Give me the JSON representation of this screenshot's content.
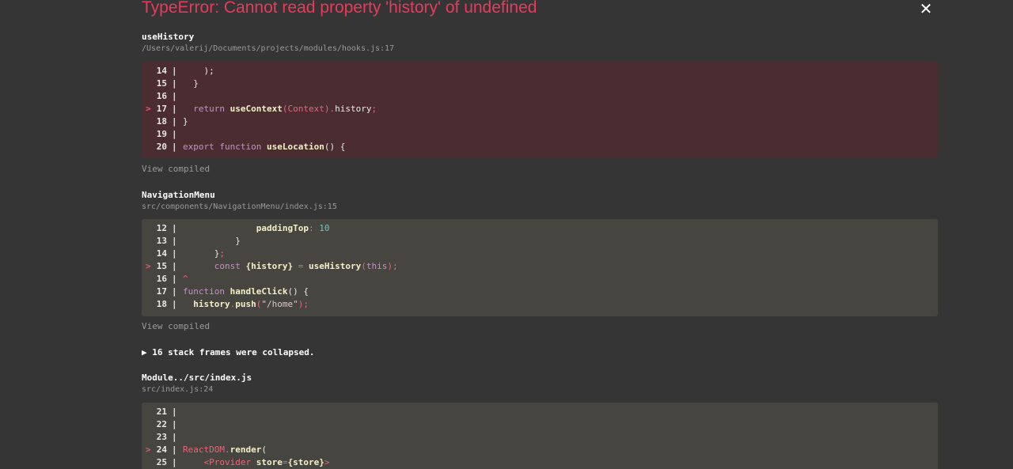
{
  "error": {
    "title": "TypeError: Cannot read property 'history' of undefined",
    "close_label": "✕"
  },
  "frames": [
    {
      "name": "useHistory",
      "path": "/Users/valerij/Documents/projects/modules/hooks.js:17",
      "type": "error",
      "lines": [
        {
          "num": "14",
          "marker": "",
          "tokens": [
            [
              "pl",
              "    );"
            ]
          ]
        },
        {
          "num": "15",
          "marker": "",
          "tokens": [
            [
              "pl",
              "  }"
            ]
          ]
        },
        {
          "num": "16",
          "marker": "",
          "tokens": []
        },
        {
          "num": "17",
          "marker": ">",
          "tokens": [
            [
              "kw",
              "  return "
            ],
            [
              "fn",
              "useContext"
            ],
            [
              "op",
              "("
            ],
            [
              "tag",
              "Context"
            ],
            [
              "op",
              ")"
            ],
            [
              "op",
              "."
            ],
            [
              "pl",
              "history"
            ],
            [
              "op",
              ";"
            ]
          ]
        },
        {
          "num": "18",
          "marker": "",
          "tokens": [
            [
              "pl",
              "}"
            ]
          ]
        },
        {
          "num": "19",
          "marker": "",
          "tokens": []
        },
        {
          "num": "20",
          "marker": "",
          "tokens": [
            [
              "kw",
              "export "
            ],
            [
              "kw",
              "function "
            ],
            [
              "fn",
              "useLocation"
            ],
            [
              "pl",
              "() {"
            ]
          ]
        }
      ],
      "view_compiled": "View compiled"
    },
    {
      "name": "NavigationMenu",
      "path": "src/components/NavigationMenu/index.js:15",
      "type": "app",
      "lines": [
        {
          "num": "12",
          "marker": "",
          "tokens": [
            [
              "prop",
              "              paddingTop"
            ],
            [
              "op",
              ": "
            ],
            [
              "num",
              "10"
            ]
          ]
        },
        {
          "num": "13",
          "marker": "",
          "tokens": [
            [
              "pl",
              "          }"
            ]
          ]
        },
        {
          "num": "14",
          "marker": "",
          "tokens": [
            [
              "pl",
              "      }"
            ],
            [
              "op",
              ";"
            ]
          ]
        },
        {
          "num": "15",
          "marker": ">",
          "tokens": [
            [
              "kw",
              "      const "
            ],
            [
              "prop",
              "{history}"
            ],
            [
              "op",
              " = "
            ],
            [
              "fn",
              "useHistory"
            ],
            [
              "op",
              "("
            ],
            [
              "kw",
              "this"
            ],
            [
              "op",
              ");"
            ]
          ]
        },
        {
          "num": "16",
          "marker": "",
          "tokens": [
            [
              "op",
              "^"
            ]
          ]
        },
        {
          "num": "17",
          "marker": "",
          "tokens": [
            [
              "kw",
              "function "
            ],
            [
              "fn",
              "handleClick"
            ],
            [
              "pl",
              "() {"
            ]
          ]
        },
        {
          "num": "18",
          "marker": "",
          "tokens": [
            [
              "prop",
              "  history"
            ],
            [
              "op",
              "."
            ],
            [
              "fn",
              "push"
            ],
            [
              "op",
              "("
            ],
            [
              "str",
              "\"/home\""
            ],
            [
              "op",
              ");"
            ]
          ]
        }
      ],
      "view_compiled": "View compiled"
    },
    {
      "name": "Module../src/index.js",
      "path": "src/index.js:24",
      "type": "app",
      "lines": [
        {
          "num": "21",
          "marker": "",
          "tokens": []
        },
        {
          "num": "22",
          "marker": "",
          "tokens": []
        },
        {
          "num": "23",
          "marker": "",
          "tokens": []
        },
        {
          "num": "24",
          "marker": ">",
          "tokens": [
            [
              "tag",
              "ReactDOM"
            ],
            [
              "op",
              "."
            ],
            [
              "fn",
              "render"
            ],
            [
              "pl",
              "("
            ]
          ]
        },
        {
          "num": "25",
          "marker": "",
          "tokens": [
            [
              "tag",
              "    <Provider "
            ],
            [
              "prop",
              "store"
            ],
            [
              "op",
              "="
            ],
            [
              "prop",
              "{store}"
            ],
            [
              "tag",
              ">"
            ]
          ]
        }
      ],
      "view_compiled": ""
    }
  ],
  "collapsed_frames": "▶ 16 stack frames were collapsed.",
  "colors": {
    "background": "#353535",
    "error_title": "#e83b5c",
    "error_code_bg": "#4b2d31",
    "app_code_bg": "#464540"
  }
}
